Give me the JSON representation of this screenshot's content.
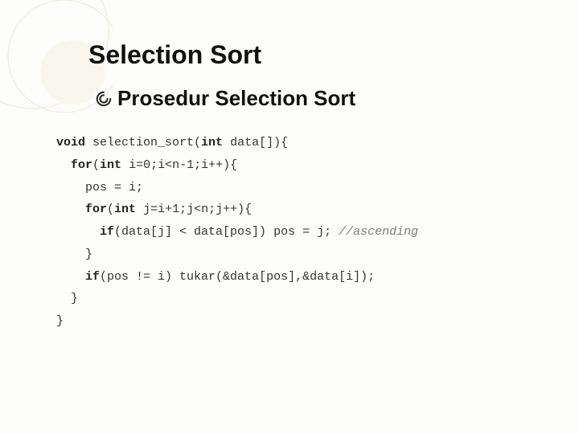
{
  "title": "Selection Sort",
  "subtitle": "Prosedur Selection Sort",
  "code": {
    "l1_kw": "void",
    "l1_rest": " selection_sort(",
    "l1_kw2": "int",
    "l1_rest2": " data[]){",
    "l2_pre": "  ",
    "l2_kw": "for",
    "l2_rest": "(",
    "l2_kw2": "int",
    "l2_rest2": " i=0;i<n-1;i++){",
    "l3": "    pos = i;",
    "l4_pre": "    ",
    "l4_kw": "for",
    "l4_rest": "(",
    "l4_kw2": "int",
    "l4_rest2": " j=i+1;j<n;j++){",
    "l5_pre": "      ",
    "l5_kw": "if",
    "l5_rest": "(data[j] < data[pos]) pos = j; ",
    "l5_cm": "//ascending",
    "l6": "    }",
    "l7_pre": "    ",
    "l7_kw": "if",
    "l7_rest": "(pos != i) tukar(&data[pos],&data[i]);",
    "l8": "  }",
    "l9": "}"
  }
}
